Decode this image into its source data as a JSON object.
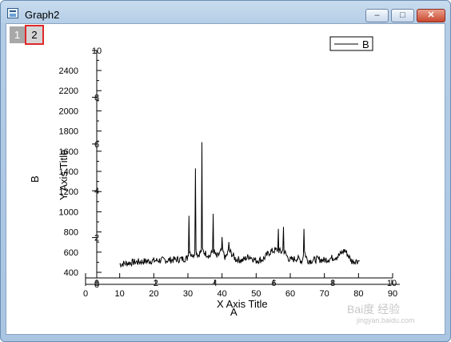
{
  "window": {
    "title": "Graph2",
    "minimize_glyph": "–",
    "maximize_glyph": "□",
    "close_glyph": "✕"
  },
  "layers": [
    {
      "label": "1"
    },
    {
      "label": "2"
    }
  ],
  "legend": {
    "entry": "B"
  },
  "overlay_texts": {
    "layer1_xlabel": "X Axis Title",
    "layer1_ylabel": "Y Axis Title",
    "layer2_xlabel": "A",
    "layer2_ylabel": "B"
  },
  "watermark": {
    "text": "Bai度 经验",
    "sub": "jingyan.baidu.com"
  },
  "colors": {
    "line": "#000000",
    "highlight": "#e0292a"
  },
  "chart_data": [
    {
      "type": "line",
      "name": "layer-2 plot",
      "xlabel": "A",
      "ylabel": "B",
      "xlim": [
        0,
        90
      ],
      "ylim": [
        400,
        2500
      ],
      "x_ticks": [
        0,
        10,
        20,
        30,
        40,
        50,
        60,
        70,
        80,
        90
      ],
      "y_ticks": [
        400,
        600,
        800,
        1000,
        1200,
        1400,
        1600,
        1800,
        2000,
        2200,
        2400
      ],
      "legend": [
        "B"
      ],
      "series": [
        {
          "name": "B",
          "x": [
            10,
            12,
            14,
            16,
            18,
            20,
            22,
            24,
            26,
            28,
            29.8,
            30.3,
            31.5,
            32.2,
            33,
            34.1,
            34.7,
            35.5,
            36.5,
            37.4,
            38.5,
            40,
            41,
            42,
            44,
            46,
            48,
            50,
            52,
            54,
            55.5,
            56.5,
            57.3,
            58,
            59,
            60,
            62,
            63.5,
            64,
            65,
            66,
            68,
            70,
            72,
            74,
            76,
            78,
            80,
            80.3
          ],
          "y": [
            480,
            490,
            500,
            505,
            510,
            515,
            520,
            520,
            525,
            530,
            540,
            960,
            560,
            1430,
            570,
            1690,
            600,
            580,
            560,
            980,
            550,
            750,
            540,
            700,
            530,
            520,
            560,
            515,
            530,
            600,
            640,
            830,
            600,
            850,
            560,
            520,
            540,
            510,
            830,
            520,
            515,
            530,
            520,
            540,
            560,
            620,
            510,
            515,
            510
          ]
        }
      ]
    },
    {
      "type": "line",
      "name": "layer-1 axes",
      "xlabel": "X Axis Title",
      "ylabel": "Y Axis Title",
      "xlim": [
        0,
        10
      ],
      "ylim": [
        0,
        10
      ],
      "x_ticks": [
        0,
        2,
        4,
        6,
        8,
        10
      ],
      "y_ticks": [
        0,
        2,
        4,
        6,
        8,
        10
      ],
      "series": []
    }
  ]
}
